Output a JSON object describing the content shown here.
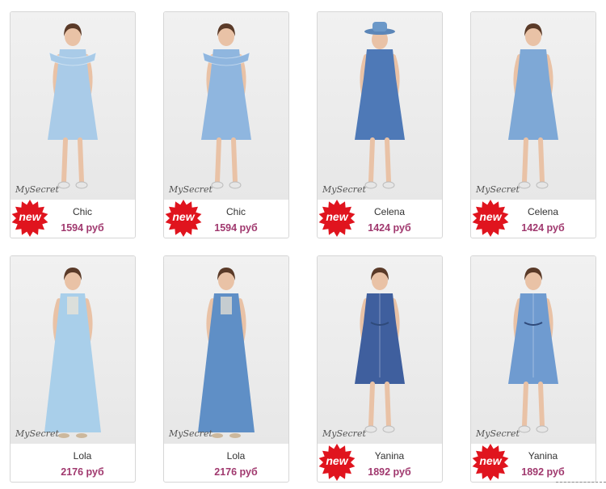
{
  "products": [
    {
      "name": "Chic",
      "price": "1594 руб",
      "brand": "MySecret",
      "badge": "new",
      "dress_color": "#a9cbe8",
      "style": "short-ruffle"
    },
    {
      "name": "Chic",
      "price": "1594 руб",
      "brand": "MySecret",
      "badge": "new",
      "dress_color": "#8fb6df",
      "style": "short-ruffle"
    },
    {
      "name": "Celena",
      "price": "1424 руб",
      "brand": "MySecret",
      "badge": "new",
      "dress_color": "#4e79b7",
      "style": "short-hat"
    },
    {
      "name": "Celena",
      "price": "1424 руб",
      "brand": "MySecret",
      "badge": "new",
      "dress_color": "#7ea8d6",
      "style": "short"
    },
    {
      "name": "Lola",
      "price": "2176 руб",
      "brand": "MySecret",
      "badge": "",
      "dress_color": "#a9cfea",
      "style": "long"
    },
    {
      "name": "Lola",
      "price": "2176 руб",
      "brand": "MySecret",
      "badge": "",
      "dress_color": "#5f8fc6",
      "style": "long"
    },
    {
      "name": "Yanina",
      "price": "1892 руб",
      "brand": "MySecret",
      "badge": "new",
      "dress_color": "#3f5f9e",
      "style": "shirt"
    },
    {
      "name": "Yanina",
      "price": "1892 руб",
      "brand": "MySecret",
      "badge": "new",
      "dress_color": "#6f9bd0",
      "style": "shirt"
    }
  ],
  "badge_color": "#e0141e",
  "price_color": "#a0386e"
}
